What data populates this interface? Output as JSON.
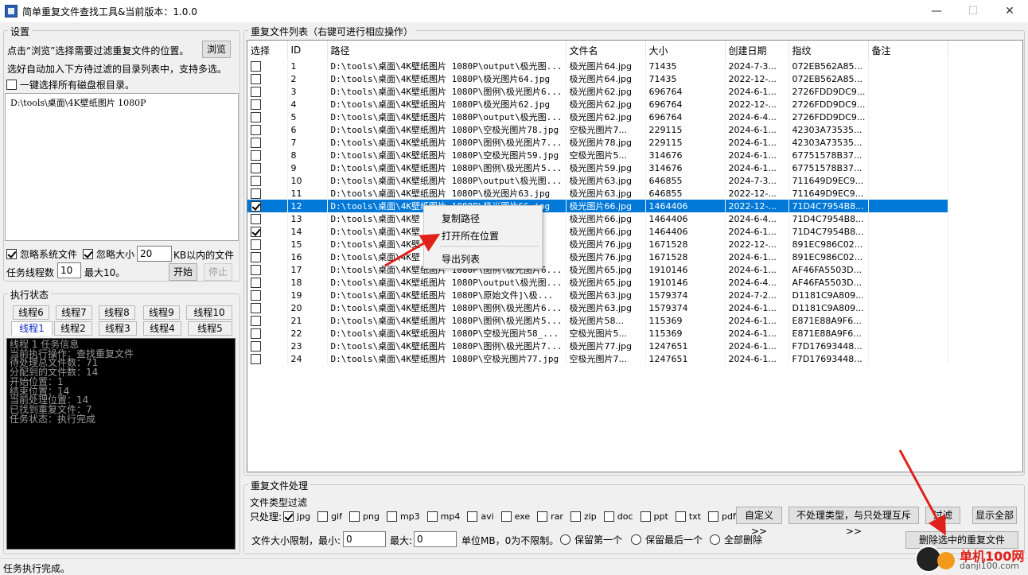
{
  "window": {
    "title": "简单重复文件查找工具&当前版本：1.0.0",
    "min": "—",
    "max": "☐",
    "close": "✕"
  },
  "settings": {
    "group_label": "设置",
    "browse_hint": "点击“浏览”选择需要过滤重复文件的位置。",
    "browse_button": "浏览",
    "auto_hint": "选好自动加入下方待过滤的目录列表中，支持多选。",
    "select_all_roots": "一键选择所有磁盘根目录。",
    "dir_list": [
      "D:\\tools\\桌面\\4K壁纸图片 1080P"
    ],
    "ignore_system": "忽略系统文件",
    "ignore_size": "忽略大小",
    "size_value": "20",
    "size_suffix": "KB以内的文件",
    "threads_label": "任务线程数",
    "threads_value": "10",
    "threads_max": "最大10。",
    "start_button": "开始",
    "stop_button": "停止"
  },
  "exec": {
    "group_label": "执行状态",
    "tabs_row1": [
      "线程6",
      "线程7",
      "线程8",
      "线程9",
      "线程10"
    ],
    "tabs_row2": [
      "线程1",
      "线程2",
      "线程3",
      "线程4",
      "线程5"
    ],
    "console_lines": [
      "线程 1 任务信息",
      "当前执行操作：查找重复文件",
      "待处理总文件数：71",
      "分配到的文件数：14",
      "开始位置：1",
      "结束位置：14",
      "当前处理位置：14",
      "已找到重复文件：7",
      "任务状态：执行完成"
    ]
  },
  "list": {
    "group_label": "重复文件列表（右键可进行相应操作）",
    "columns": [
      "选择",
      "ID",
      "路径",
      "文件名",
      "大小",
      "创建日期",
      "指纹",
      "备注"
    ],
    "rows": [
      {
        "checked": false,
        "id": "1",
        "path": "D:\\tools\\桌面\\4K壁纸图片 1080P\\output\\极光图...",
        "name": "极光图片64.jpg",
        "size": "71435",
        "date": "2024-7-3...",
        "hash": "072EB562A85..."
      },
      {
        "checked": false,
        "id": "2",
        "path": "D:\\tools\\桌面\\4K壁纸图片 1080P\\极光图片64.jpg",
        "name": "极光图片64.jpg",
        "size": "71435",
        "date": "2022-12-...",
        "hash": "072EB562A85..."
      },
      {
        "checked": false,
        "id": "3",
        "path": "D:\\tools\\桌面\\4K壁纸图片 1080P\\图例\\极光图片6...",
        "name": "极光图片62.jpg",
        "size": "696764",
        "date": "2024-6-1...",
        "hash": "2726FDD9DC9..."
      },
      {
        "checked": false,
        "id": "4",
        "path": "D:\\tools\\桌面\\4K壁纸图片 1080P\\极光图片62.jpg",
        "name": "极光图片62.jpg",
        "size": "696764",
        "date": "2022-12-...",
        "hash": "2726FDD9DC9..."
      },
      {
        "checked": false,
        "id": "5",
        "path": "D:\\tools\\桌面\\4K壁纸图片 1080P\\output\\极光图...",
        "name": "极光图片62.jpg",
        "size": "696764",
        "date": "2024-6-4...",
        "hash": "2726FDD9DC9..."
      },
      {
        "checked": false,
        "id": "6",
        "path": "D:\\tools\\桌面\\4K壁纸图片 1080P\\空极光图片78.jpg",
        "name": "空极光图片7...",
        "size": "229115",
        "date": "2024-6-1...",
        "hash": "42303A73535..."
      },
      {
        "checked": false,
        "id": "7",
        "path": "D:\\tools\\桌面\\4K壁纸图片 1080P\\图例\\极光图片7...",
        "name": "极光图片78.jpg",
        "size": "229115",
        "date": "2024-6-1...",
        "hash": "42303A73535..."
      },
      {
        "checked": false,
        "id": "8",
        "path": "D:\\tools\\桌面\\4K壁纸图片 1080P\\空极光图片59.jpg",
        "name": "空极光图片5...",
        "size": "314676",
        "date": "2024-6-1...",
        "hash": "67751578B37..."
      },
      {
        "checked": false,
        "id": "9",
        "path": "D:\\tools\\桌面\\4K壁纸图片 1080P\\图例\\极光图片5...",
        "name": "极光图片59.jpg",
        "size": "314676",
        "date": "2024-6-1...",
        "hash": "67751578B37..."
      },
      {
        "checked": false,
        "id": "10",
        "path": "D:\\tools\\桌面\\4K壁纸图片 1080P\\output\\极光图...",
        "name": "极光图片63.jpg",
        "size": "646855",
        "date": "2024-7-3...",
        "hash": "711649D9EC9..."
      },
      {
        "checked": false,
        "id": "11",
        "path": "D:\\tools\\桌面\\4K壁纸图片 1080P\\极光图片63.jpg",
        "name": "极光图片63.jpg",
        "size": "646855",
        "date": "2022-12-...",
        "hash": "711649D9EC9..."
      },
      {
        "checked": true,
        "id": "12",
        "path": "D:\\tools\\桌面\\4K壁纸图片 1080P\\极光图片66.jpg",
        "name": "极光图片66.jpg",
        "size": "1464406",
        "date": "2022-12-...",
        "hash": "71D4C7954B8...",
        "selected": true
      },
      {
        "checked": false,
        "id": "13",
        "path": "D:\\tools\\桌面\\4K壁",
        "name": "极光图片66.jpg",
        "size": "1464406",
        "date": "2024-6-4...",
        "hash": "71D4C7954B8..."
      },
      {
        "checked": true,
        "id": "14",
        "path": "D:\\tools\\桌面\\4K壁",
        "name": "极光图片66.jpg",
        "size": "1464406",
        "date": "2024-6-1...",
        "hash": "71D4C7954B8..."
      },
      {
        "checked": false,
        "id": "15",
        "path": "D:\\tools\\桌面\\4K壁",
        "name": "极光图片76.jpg",
        "size": "1671528",
        "date": "2022-12-...",
        "hash": "891EC986C02..."
      },
      {
        "checked": false,
        "id": "16",
        "path": "D:\\tools\\桌面\\4K壁",
        "name": "极光图片76.jpg",
        "size": "1671528",
        "date": "2024-6-1...",
        "hash": "891EC986C02..."
      },
      {
        "checked": false,
        "id": "17",
        "path": "D:\\tools\\桌面\\4K壁纸图片 1080P\\图例\\极光图片6...",
        "name": "极光图片65.jpg",
        "size": "1910146",
        "date": "2024-6-1...",
        "hash": "AF46FA5503D..."
      },
      {
        "checked": false,
        "id": "18",
        "path": "D:\\tools\\桌面\\4K壁纸图片 1080P\\output\\极光图...",
        "name": "极光图片65.jpg",
        "size": "1910146",
        "date": "2024-6-4...",
        "hash": "AF46FA5503D..."
      },
      {
        "checked": false,
        "id": "19",
        "path": "D:\\tools\\桌面\\4K壁纸图片 1080P\\原始文件]\\极...",
        "name": "极光图片63.jpg",
        "size": "1579374",
        "date": "2024-7-2...",
        "hash": "D1181C9A809..."
      },
      {
        "checked": false,
        "id": "20",
        "path": "D:\\tools\\桌面\\4K壁纸图片 1080P\\图例\\极光图片6...",
        "name": "极光图片63.jpg",
        "size": "1579374",
        "date": "2024-6-1...",
        "hash": "D1181C9A809..."
      },
      {
        "checked": false,
        "id": "21",
        "path": "D:\\tools\\桌面\\4K壁纸图片 1080P\\图例\\极光图片5...",
        "name": "极光图片58...",
        "size": "115369",
        "date": "2024-6-1...",
        "hash": "E871E88A9F6..."
      },
      {
        "checked": false,
        "id": "22",
        "path": "D:\\tools\\桌面\\4K壁纸图片 1080P\\空极光图片58_...",
        "name": "空极光图片5...",
        "size": "115369",
        "date": "2024-6-1...",
        "hash": "E871E88A9F6..."
      },
      {
        "checked": false,
        "id": "23",
        "path": "D:\\tools\\桌面\\4K壁纸图片 1080P\\图例\\极光图片7...",
        "name": "极光图片77.jpg",
        "size": "1247651",
        "date": "2024-6-1...",
        "hash": "F7D17693448..."
      },
      {
        "checked": false,
        "id": "24",
        "path": "D:\\tools\\桌面\\4K壁纸图片 1080P\\空极光图片77.jpg",
        "name": "空极光图片7...",
        "size": "1247651",
        "date": "2024-6-1...",
        "hash": "F7D17693448..."
      }
    ]
  },
  "context_menu": {
    "items": [
      "复制路径",
      "打开所在位置",
      "导出列表"
    ]
  },
  "process": {
    "group_label": "重复文件处理",
    "type_label": "文件类型过滤",
    "only_label": "只处理:",
    "types": [
      {
        "label": "jpg",
        "checked": true
      },
      {
        "label": "gif",
        "checked": false
      },
      {
        "label": "png",
        "checked": false
      },
      {
        "label": "mp3",
        "checked": false
      },
      {
        "label": "mp4",
        "checked": false
      },
      {
        "label": "avi",
        "checked": false
      },
      {
        "label": "exe",
        "checked": false
      },
      {
        "label": "rar",
        "checked": false
      },
      {
        "label": "zip",
        "checked": false
      },
      {
        "label": "doc",
        "checked": false
      },
      {
        "label": "ppt",
        "checked": false
      },
      {
        "label": "txt",
        "checked": false
      },
      {
        "label": "pdf",
        "checked": false
      },
      {
        "label": "iso",
        "checked": false
      }
    ],
    "custom_button": "自定义>>",
    "exclude_button": "不处理类型，与只处理互斥>>",
    "filter_button": "过滤",
    "show_all_button": "显示全部",
    "size_limit_label": "文件大小限制，最小:",
    "min_value": "0",
    "max_label": "最大:",
    "max_value": "0",
    "unit_label": "单位MB，0为不限制。",
    "keep_first": "保留第一个",
    "keep_last": "保留最后一个",
    "delete_all": "全部删除",
    "delete_selected_button": "删除选中的重复文件"
  },
  "status": {
    "text": "任务执行完成。"
  },
  "watermark": {
    "text": "单机100网",
    "url": "danji100.com"
  },
  "colors": {
    "selection": "#0078d7",
    "annotation": "#e0201a"
  }
}
